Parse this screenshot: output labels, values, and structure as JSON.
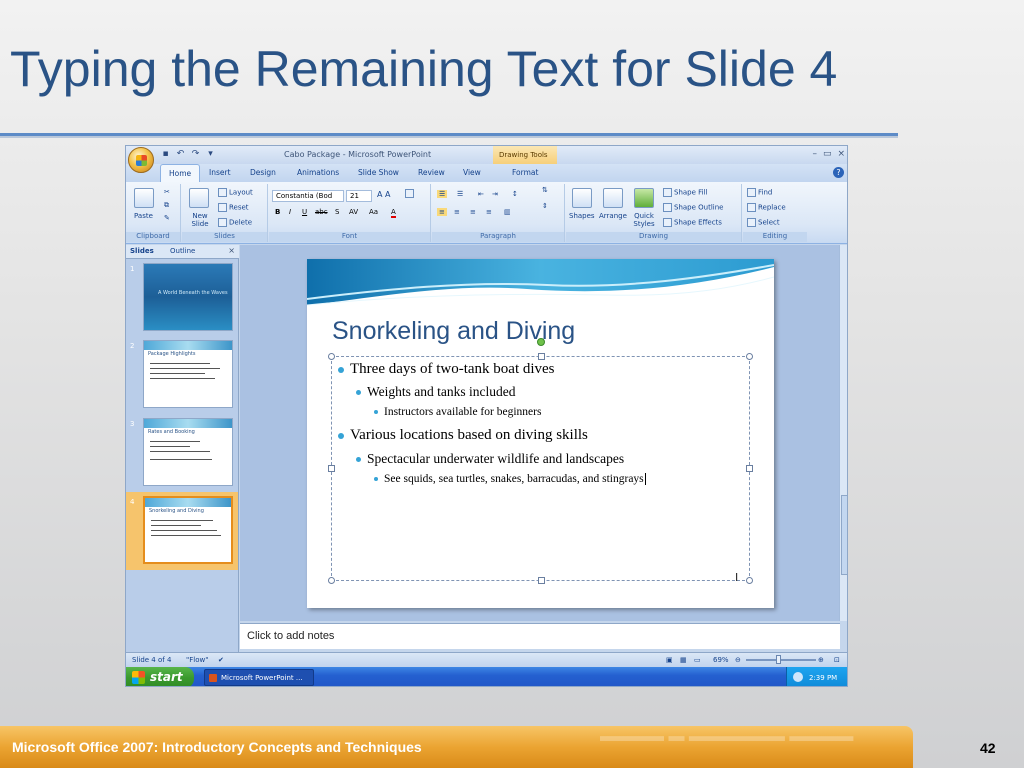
{
  "presentation": {
    "slide_title": "Typing the Remaining Text for Slide 4",
    "footer": "Microsoft Office 2007: Introductory Concepts and Techniques",
    "page_number": "42"
  },
  "window": {
    "title": "Cabo Package - Microsoft PowerPoint",
    "contextual_tab": "Drawing Tools",
    "controls": [
      "–",
      "▭",
      "×"
    ]
  },
  "tabs": [
    "Home",
    "Insert",
    "Design",
    "Animations",
    "Slide Show",
    "Review",
    "View",
    "Format"
  ],
  "ribbon": {
    "clipboard": {
      "label": "Clipboard",
      "paste": "Paste"
    },
    "slides": {
      "label": "Slides",
      "new_slide": "New Slide",
      "layout": "Layout",
      "reset": "Reset",
      "delete": "Delete"
    },
    "font": {
      "label": "Font",
      "font_name": "Constantia (Bod",
      "font_size": "21"
    },
    "paragraph": {
      "label": "Paragraph"
    },
    "drawing": {
      "label": "Drawing",
      "shapes": "Shapes",
      "arrange": "Arrange",
      "quick_styles": "Quick Styles",
      "shape_fill": "Shape Fill",
      "shape_outline": "Shape Outline",
      "shape_effects": "Shape Effects"
    },
    "editing": {
      "label": "Editing",
      "find": "Find",
      "replace": "Replace",
      "select": "Select"
    }
  },
  "left_pane": {
    "tabs": [
      "Slides",
      "Outline"
    ],
    "thumbnails": [
      {
        "number": "1",
        "title": "A World Beneath the Waves"
      },
      {
        "number": "2",
        "title": "Package Highlights"
      },
      {
        "number": "3",
        "title": "Rates and Booking"
      },
      {
        "number": "4",
        "title": "Snorkeling and Diving"
      }
    ]
  },
  "slide": {
    "title": "Snorkeling and Diving",
    "bullets": [
      {
        "level": 1,
        "text": "Three days of two-tank boat dives"
      },
      {
        "level": 2,
        "text": "Weights and tanks included"
      },
      {
        "level": 3,
        "text": "Instructors available for beginners"
      },
      {
        "level": 1,
        "text": "Various locations based on diving skills"
      },
      {
        "level": 2,
        "text": "Spectacular underwater wildlife and landscapes"
      },
      {
        "level": 3,
        "text": "See squids, sea turtles, snakes, barracudas, and stingrays"
      }
    ]
  },
  "notes_placeholder": "Click to add notes",
  "status": {
    "slide_info": "Slide 4 of 4",
    "theme": "\"Flow\"",
    "zoom": "69%"
  },
  "taskbar": {
    "start": "start",
    "task": "Microsoft PowerPoint ...",
    "time": "2:39 PM"
  },
  "colors": {
    "title_blue": "#2a5386",
    "bullet_blue": "#35a3d6",
    "footer_orange": "#eba432",
    "selected_thumb_orange": "#f2a33b"
  }
}
